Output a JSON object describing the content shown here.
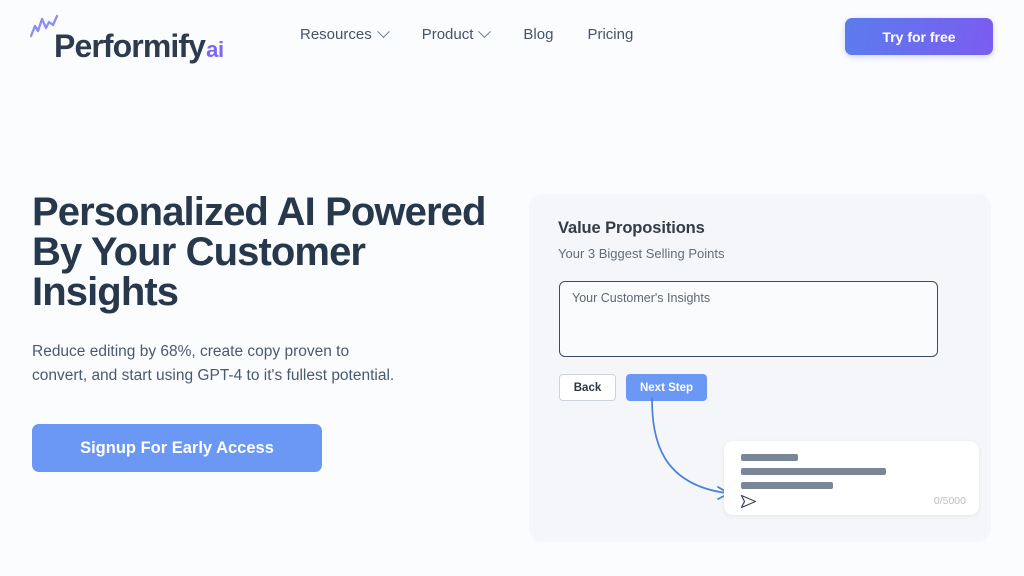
{
  "header": {
    "brand": {
      "name": "Performify",
      "suffix": "ai",
      "mark_icon": "chart-zigzag-icon",
      "accent_color": "#7b68f0"
    },
    "nav": [
      {
        "label": "Resources",
        "has_chevron": true,
        "icon": "chevron-down-icon"
      },
      {
        "label": "Product",
        "has_chevron": true,
        "icon": "chevron-down-icon"
      },
      {
        "label": "Blog",
        "has_chevron": false
      },
      {
        "label": "Pricing",
        "has_chevron": false
      }
    ],
    "cta": {
      "label": "Try for free",
      "gradient_from": "#5b7ced",
      "gradient_to": "#7b5cf0"
    }
  },
  "hero": {
    "title": "Personalized AI Powered\nBy Your Customer\nInsights",
    "subtitle": "Reduce editing by 68%, create copy proven to\nconvert, and start using GPT-4 to it's fullest potential.",
    "cta": {
      "label": "Signup For Early Access",
      "color": "#6b97f5"
    }
  },
  "mockup": {
    "title": "Value Propositions",
    "subtitle": "Your 3 Biggest Selling Points",
    "insights_input": {
      "value": "",
      "placeholder": "Your Customer's Insights"
    },
    "buttons": {
      "back": "Back",
      "next": "Next Step"
    },
    "arrow_icon": "curved-arrow-icon",
    "chat": {
      "send_icon": "send-paper-plane-icon",
      "counter": "0/5000",
      "placeholder_bars": [
        57,
        145,
        92
      ],
      "bar_color": "#7b8696"
    }
  }
}
